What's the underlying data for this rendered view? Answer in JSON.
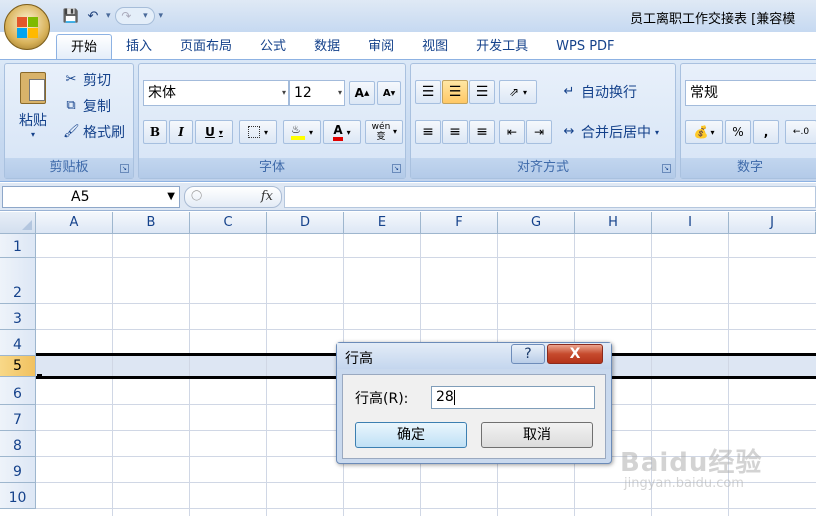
{
  "window": {
    "title": "员工离职工作交接表 [兼容模"
  },
  "qat": {
    "save_icon": "save-icon",
    "undo_icon": "undo-icon",
    "redo_icon": "redo-icon"
  },
  "tabs": [
    {
      "label": "开始",
      "active": true
    },
    {
      "label": "插入"
    },
    {
      "label": "页面布局"
    },
    {
      "label": "公式"
    },
    {
      "label": "数据"
    },
    {
      "label": "审阅"
    },
    {
      "label": "视图"
    },
    {
      "label": "开发工具"
    },
    {
      "label": "WPS PDF"
    }
  ],
  "ribbon": {
    "clipboard": {
      "label": "剪贴板",
      "paste": "粘贴",
      "cut": "剪切",
      "copy": "复制",
      "format_painter": "格式刷"
    },
    "font": {
      "label": "字体",
      "font_name": "宋体",
      "font_size": "12",
      "bold": "B",
      "italic": "I",
      "underline": "U",
      "grow": "A",
      "shrink": "A",
      "font_color_glyph": "A",
      "phonetic": "wén 变"
    },
    "alignment": {
      "label": "对齐方式",
      "wrap_text": "自动换行",
      "merge_center": "合并后居中"
    },
    "number": {
      "label": "数字",
      "format": "常规",
      "percent": "%",
      "comma": ","
    }
  },
  "formula_bar": {
    "name_box": "A5",
    "fx": "fx",
    "formula": ""
  },
  "grid": {
    "columns": [
      "A",
      "B",
      "C",
      "D",
      "E",
      "F",
      "G",
      "H",
      "I",
      "J"
    ],
    "rows": [
      "1",
      "2",
      "3",
      "4",
      "5",
      "6",
      "7",
      "8",
      "9",
      "10"
    ],
    "selected_row": "5"
  },
  "dialog": {
    "title": "行高",
    "help": "?",
    "close": "X",
    "label": "行高(R):",
    "value": "28",
    "ok": "确定",
    "cancel": "取消"
  },
  "watermark": {
    "text": "Baidu经验",
    "url": "jingyan.baidu.com"
  },
  "colors": {
    "ribbon_bg": "#c5d8f0",
    "selected_header": "#f1c15f",
    "dialog_close": "#c64a2d"
  }
}
